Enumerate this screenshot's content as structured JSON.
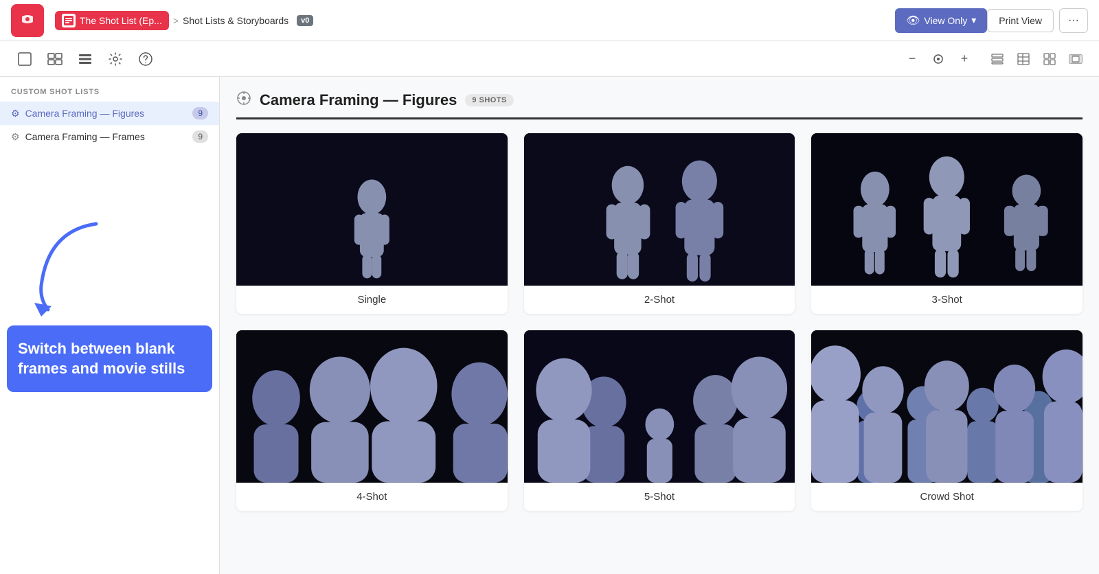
{
  "nav": {
    "logo_alt": "StudioBinder Logo",
    "breadcrumb_home": "The Shot List (Ep...",
    "breadcrumb_sep": ">",
    "breadcrumb_current": "Shot Lists & Storyboards",
    "version": "v0",
    "view_only_label": "View Only",
    "print_view_label": "Print View",
    "more_label": "···"
  },
  "toolbar": {
    "btn1_title": "Frame",
    "btn2_title": "Grid",
    "btn3_title": "List",
    "btn4_title": "Settings",
    "btn5_title": "Help"
  },
  "sidebar": {
    "section_title": "CUSTOM SHOT LISTS",
    "items": [
      {
        "label": "Camera Framing — Figures",
        "count": "9",
        "active": true
      },
      {
        "label": "Camera Framing — Frames",
        "count": "9",
        "active": false
      }
    ],
    "tooltip": {
      "text": "Switch between blank frames and movie stills"
    }
  },
  "content": {
    "section_icon": "⊕",
    "section_title": "Camera Framing — Figures",
    "shots_badge": "9 SHOTS",
    "shots": [
      {
        "label": "Single",
        "type": "single"
      },
      {
        "label": "2-Shot",
        "type": "two"
      },
      {
        "label": "3-Shot",
        "type": "three"
      },
      {
        "label": "4-Shot",
        "type": "four"
      },
      {
        "label": "5-Shot",
        "type": "five"
      },
      {
        "label": "Crowd Shot",
        "type": "crowd"
      }
    ]
  }
}
